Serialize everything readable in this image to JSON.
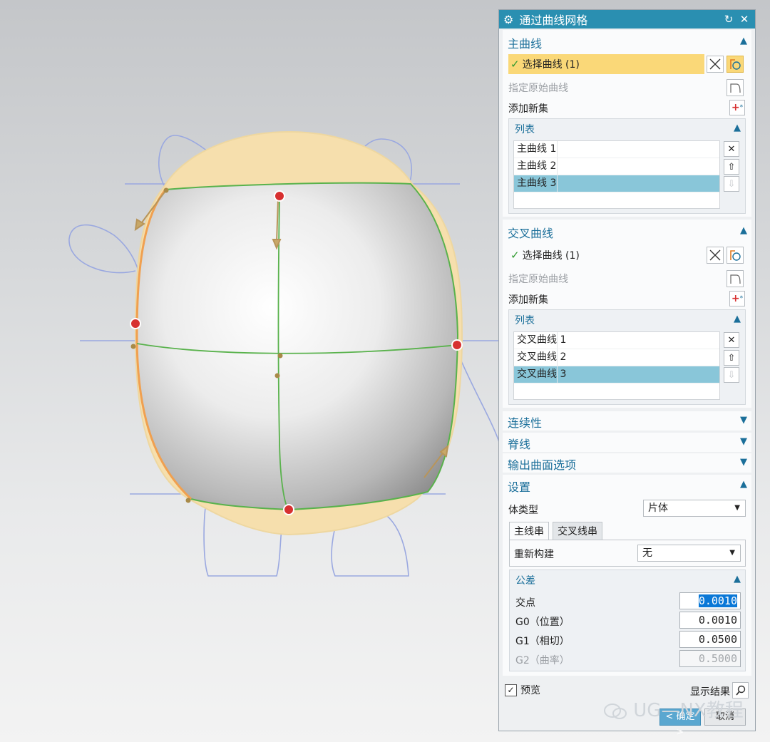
{
  "dialog": {
    "title": "通过曲线网格",
    "title_icons": [
      "gear-icon",
      "reset-icon",
      "close-icon"
    ],
    "primary": {
      "header": "主曲线",
      "select_curve": "选择曲线 (1)",
      "specify_origin": "指定原始曲线",
      "add_new_set": "添加新集",
      "list_title": "列表",
      "items": [
        "主曲线 1",
        "主曲线 2",
        "主曲线 3"
      ],
      "selected_index": 2
    },
    "cross": {
      "header": "交叉曲线",
      "select_curve": "选择曲线 (1)",
      "specify_origin": "指定原始曲线",
      "add_new_set": "添加新集",
      "list_title": "列表",
      "items": [
        "交叉曲线 1",
        "交叉曲线 2",
        "交叉曲线 3"
      ],
      "selected_index": 2
    },
    "continuity": "连续性",
    "spine": "脊线",
    "output_options": "输出曲面选项",
    "settings": {
      "header": "设置",
      "body_type_label": "体类型",
      "body_type_value": "片体",
      "tabs": [
        "主线串",
        "交叉线串"
      ],
      "rebuild_label": "重新构建",
      "rebuild_value": "无",
      "tolerance_header": "公差",
      "tolerances": [
        {
          "label": "交点",
          "value": "0.0010"
        },
        {
          "label": "G0（位置）",
          "value": "0.0010"
        },
        {
          "label": "G1（相切）",
          "value": "0.0500"
        },
        {
          "label": "G2（曲率）",
          "value": "0.5000"
        }
      ]
    },
    "preview_label": "预览",
    "preview_checked": true,
    "show_result_label": "显示结果",
    "ok_label": "< 确定 >",
    "cancel_label": "取消"
  },
  "watermark": "UG—NX教程",
  "colors": {
    "titlebar": "#2a8fb1",
    "section_header": "#1b6f9a",
    "selection_yellow": "#fad878",
    "list_selected": "#89c6d9",
    "curve_blue": "#9aa8e0",
    "edge_green": "#59b24c",
    "edge_orange": "#f0a050",
    "surface_fill": "#f6dfad"
  }
}
